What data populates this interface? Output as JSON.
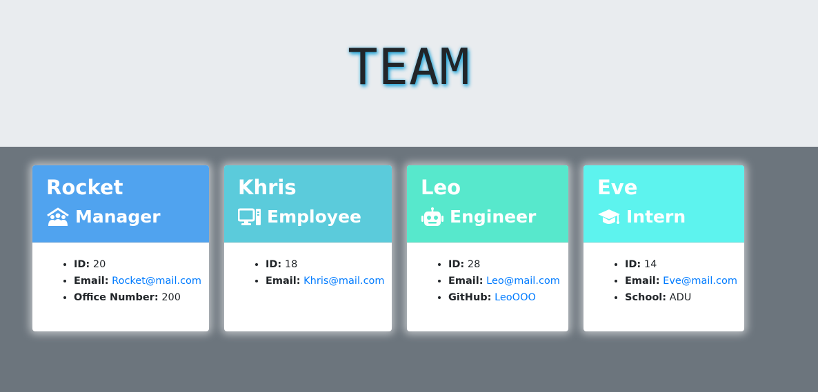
{
  "header": {
    "title": "TEAM"
  },
  "labels": {
    "id": "ID:",
    "email": "Email:",
    "office": "Office Number:",
    "github": "GitHub:",
    "school": "School:"
  },
  "cards": [
    {
      "name": "Rocket",
      "role": "Manager",
      "icon": "manager-house-people-icon",
      "color": "#50a3ef",
      "id": "20",
      "email": "Rocket@mail.com",
      "extra": "200"
    },
    {
      "name": "Khris",
      "role": "Employee",
      "icon": "desktop-computer-icon",
      "color": "#5bcbdb",
      "id": "18",
      "email": "Khris@mail.com"
    },
    {
      "name": "Leo",
      "role": "Engineer",
      "icon": "robot-icon",
      "color": "#57e8cc",
      "id": "28",
      "email": "Leo@mail.com",
      "extra": "LeoOOO"
    },
    {
      "name": "Eve",
      "role": "Intern",
      "icon": "graduation-cap-icon",
      "color": "#5df3ee",
      "id": "14",
      "email": "Eve@mail.com",
      "extra": "ADU"
    }
  ]
}
